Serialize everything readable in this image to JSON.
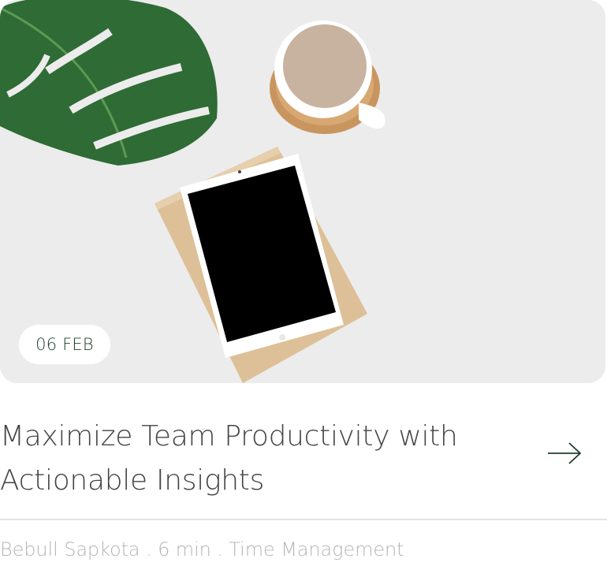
{
  "post": {
    "date": "06 FEB",
    "title_line1": "Maximize Team Productivity with",
    "title_line2": "Actionable Insights",
    "meta": "Bebull Sapkota . 6 min . Time Management",
    "arrow_icon": "arrow-right-icon"
  },
  "colors": {
    "badge_text": "#1f3d2b",
    "title_text": "#444444",
    "meta_text": "#b5b5b5",
    "image_background": "#ececec"
  }
}
